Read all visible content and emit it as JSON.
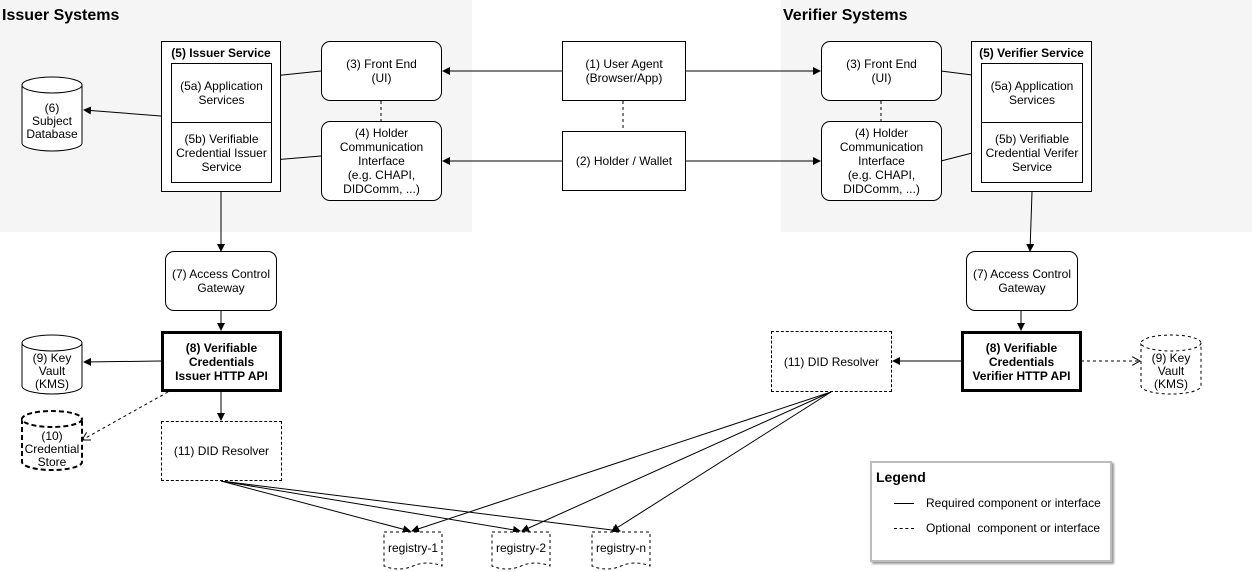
{
  "regions": {
    "issuer_title": "Issuer Systems",
    "verifier_title": "Verifier Systems"
  },
  "components": {
    "user_agent": "(1) User Agent\n(Browser/App)",
    "holder_wallet": "(2) Holder / Wallet",
    "issuer_front_end": "(3) Front End\n(UI)",
    "issuer_holder_comm": "(4) Holder\nCommunication\nInterface\n(e.g. CHAPI,\nDIDComm, ...)",
    "verifier_front_end": "(3) Front End\n(UI)",
    "verifier_holder_comm": "(4) Holder\nCommunication\nInterface\n(e.g. CHAPI,\nDIDComm, ...)",
    "issuer_service": {
      "title": "(5) Issuer Service",
      "app_services": "(5a) Application\nServices",
      "vc_service": "(5b) Verifiable\nCredential Issuer\nService"
    },
    "verifier_service": {
      "title": "(5) Verifier Service",
      "app_services": "(5a) Application\nServices",
      "vc_service": "(5b) Verifiable\nCredential Verifer\nService"
    },
    "subject_database": "(6)\nSubject\nDatabase",
    "issuer_gateway": "(7) Access Control\nGateway",
    "verifier_gateway": "(7) Access Control\nGateway",
    "issuer_api": "(8) Verifiable\nCredentials\nIssuer HTTP API",
    "verifier_api": "(8) Verifiable\nCredentials\nVerifier HTTP API",
    "issuer_key_vault": "(9) Key\nVault\n(KMS)",
    "verifier_key_vault": "(9) Key\nVault\n(KMS)",
    "credential_store": "(10)\nCredential\nStore",
    "issuer_did_resolver": "(11) DID Resolver",
    "verifier_did_resolver": "(11) DID Resolver",
    "registries": [
      "registry-1",
      "registry-2",
      "registry-n"
    ]
  },
  "legend": {
    "title": "Legend",
    "items": [
      {
        "style": "solid",
        "label": "Required component or interface"
      },
      {
        "style": "dashed",
        "label": "Optional  component or interface"
      }
    ]
  }
}
